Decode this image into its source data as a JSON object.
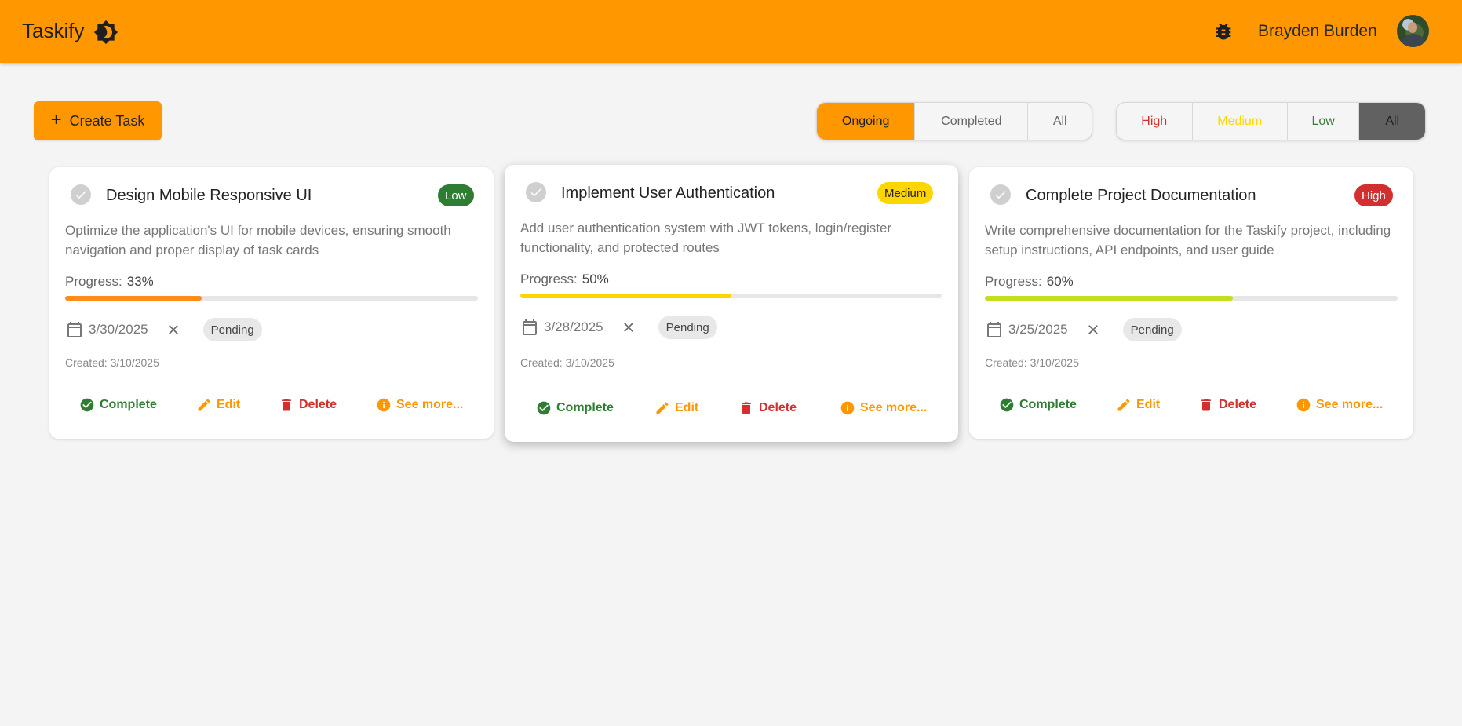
{
  "header": {
    "app_name": "Taskify",
    "user_name": "Brayden Burden",
    "icons": {
      "theme": "brightness-icon",
      "bug": "bug-icon"
    }
  },
  "toolbar": {
    "create_label": "Create Task",
    "status_filters": [
      "Ongoing",
      "Completed",
      "All"
    ],
    "status_selected": "Ongoing",
    "priority_filters": [
      "High",
      "Medium",
      "Low",
      "All"
    ],
    "priority_selected": "All"
  },
  "colors": {
    "accent": "#ff9800",
    "high": "#d32f2f",
    "medium": "#fdd600",
    "low": "#2e7d32"
  },
  "cards": [
    {
      "title": "Design Mobile Responsive UI",
      "priority": "Low",
      "description": "Optimize the application's UI for mobile devices, ensuring smooth navigation and proper display of task cards",
      "progress_label": "Progress:",
      "progress": "33%",
      "due_date": "3/30/2025",
      "status": "Pending",
      "created": "Created: 3/10/2025",
      "actions": {
        "complete": "Complete",
        "edit": "Edit",
        "delete": "Delete",
        "more": "See more..."
      }
    },
    {
      "title": "Implement User Authentication",
      "priority": "Medium",
      "description": "Add user authentication system with JWT tokens, login/register functionality, and protected routes",
      "progress_label": "Progress:",
      "progress": "50%",
      "due_date": "3/28/2025",
      "status": "Pending",
      "created": "Created: 3/10/2025",
      "actions": {
        "complete": "Complete",
        "edit": "Edit",
        "delete": "Delete",
        "more": "See more..."
      }
    },
    {
      "title": "Complete Project Documentation",
      "priority": "High",
      "description": "Write comprehensive documentation for the Taskify project, including setup instructions, API endpoints, and user guide",
      "progress_label": "Progress:",
      "progress": "60%",
      "due_date": "3/25/2025",
      "status": "Pending",
      "created": "Created: 3/10/2025",
      "actions": {
        "complete": "Complete",
        "edit": "Edit",
        "delete": "Delete",
        "more": "See more..."
      }
    }
  ]
}
